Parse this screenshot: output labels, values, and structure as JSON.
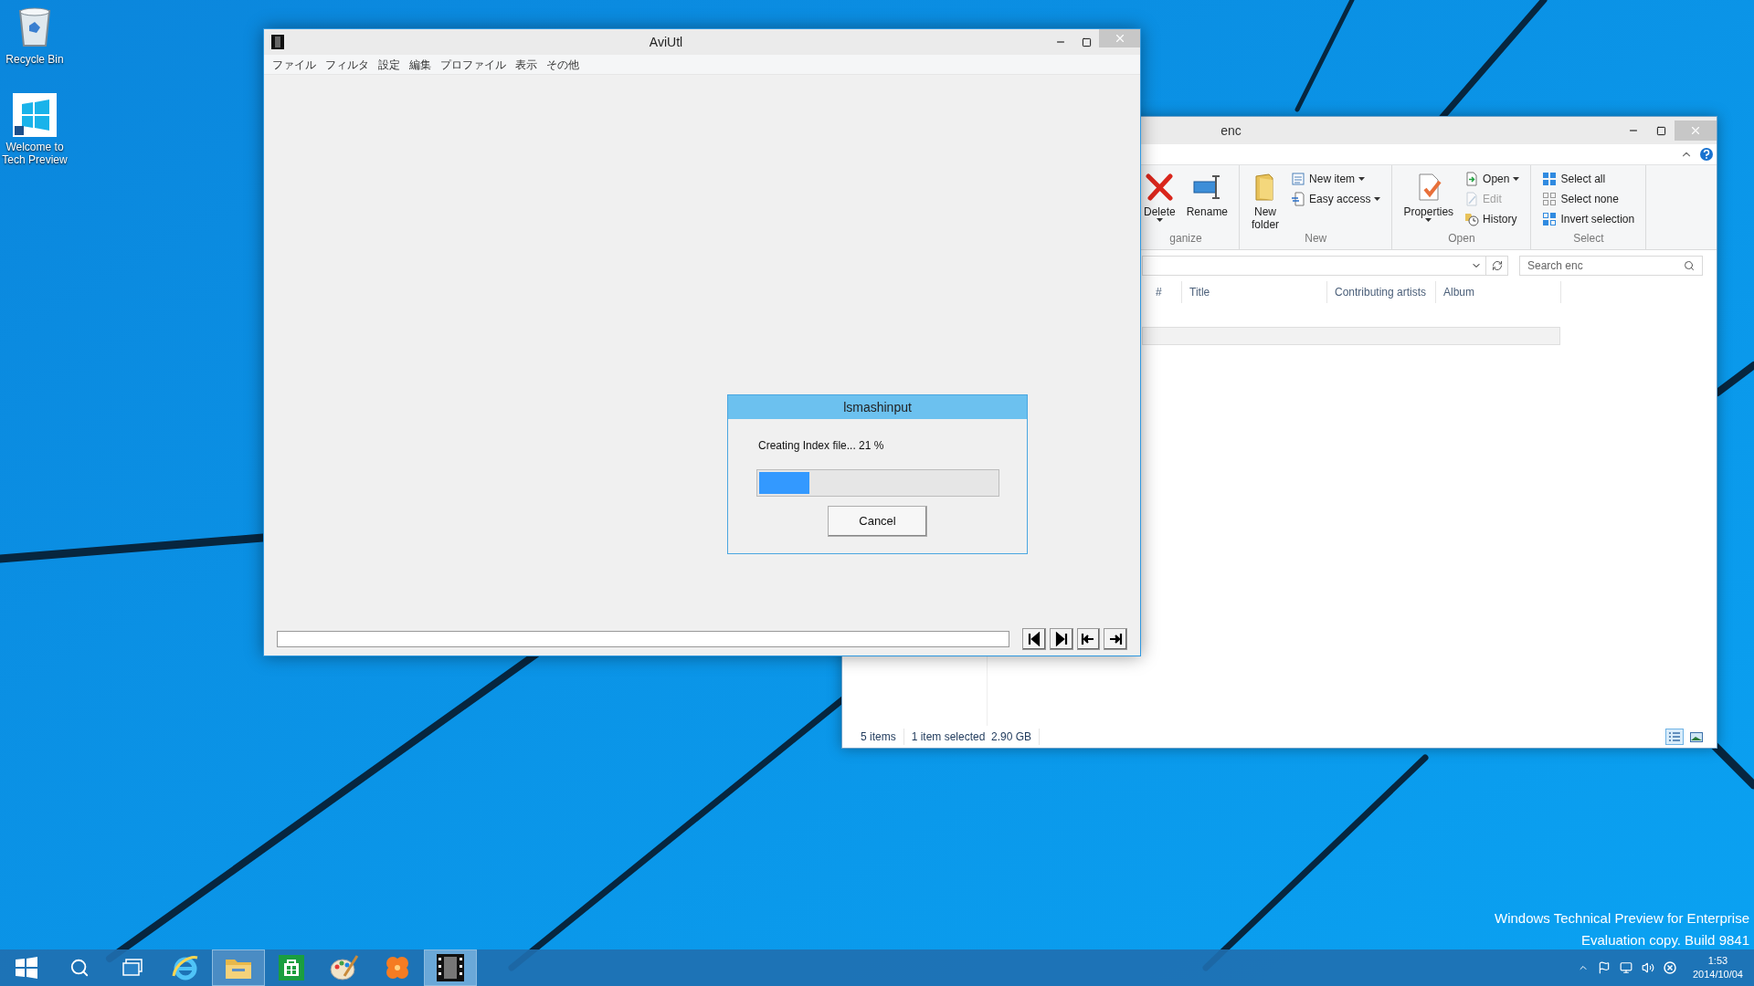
{
  "desktop_icons": [
    {
      "label": "Recycle Bin",
      "kind": "recycle"
    },
    {
      "label": "Welcome to Tech Preview",
      "kind": "welcome"
    }
  ],
  "explorer": {
    "title": "enc",
    "ribbon_groups": [
      {
        "label": "ganize",
        "items": [
          {
            "label": "Delete",
            "kind": "delete",
            "large": true,
            "dropdown": true,
            "disabled": false
          },
          {
            "label": "Rename",
            "kind": "rename",
            "large": true,
            "dropdown": false,
            "disabled": false
          }
        ]
      },
      {
        "label": "New",
        "items": [
          {
            "label_lines": [
              "New",
              "folder"
            ],
            "kind": "folder",
            "large": true,
            "dropdown": false,
            "disabled": false
          },
          {
            "label": "New item",
            "kind": "newitem",
            "large": false,
            "dropdown": true,
            "disabled": false
          },
          {
            "label": "Easy access",
            "kind": "easyaccess",
            "large": false,
            "dropdown": true,
            "disabled": false
          }
        ]
      },
      {
        "label": "Open",
        "items": [
          {
            "label": "Properties",
            "kind": "properties",
            "large": true,
            "dropdown": true,
            "disabled": false
          },
          {
            "label": "Open",
            "kind": "open",
            "large": false,
            "dropdown": true,
            "disabled": false
          },
          {
            "label": "Edit",
            "kind": "edit",
            "large": false,
            "dropdown": false,
            "disabled": true
          },
          {
            "label": "History",
            "kind": "history",
            "large": false,
            "dropdown": false,
            "disabled": false
          }
        ]
      },
      {
        "label": "Select",
        "items": [
          {
            "label": "Select all",
            "kind": "selectall",
            "large": false,
            "dropdown": false,
            "disabled": false
          },
          {
            "label": "Select none",
            "kind": "selectnone",
            "large": false,
            "dropdown": false,
            "disabled": false
          },
          {
            "label": "Invert selection",
            "kind": "invert",
            "large": false,
            "dropdown": false,
            "disabled": false
          }
        ]
      }
    ],
    "search": {
      "placeholder": "Search enc"
    },
    "columns": [
      "#",
      "Title",
      "Contributing artists",
      "Album"
    ],
    "status": [
      "5 items",
      "1 item selected  2.90 GB"
    ]
  },
  "aviutl": {
    "title": "AviUtl",
    "menu": [
      "ファイル",
      "フィルタ",
      "設定",
      "編集",
      "プロファイル",
      "表示",
      "その他"
    ],
    "dialog": {
      "title": "lsmashinput",
      "message": "Creating Index file... 21 %",
      "progress": {
        "level": 0.21
      },
      "button": "Cancel"
    }
  },
  "edition_text": [
    "Windows Technical Preview for Enterprise",
    "Evaluation copy. Build 9841"
  ],
  "taskbar": {
    "apps": [
      {
        "kind": "start",
        "running": false,
        "selected": false
      },
      {
        "kind": "search",
        "running": false,
        "selected": false
      },
      {
        "kind": "taskview",
        "running": false,
        "selected": false
      },
      {
        "kind": "ie",
        "running": false,
        "selected": false
      },
      {
        "kind": "explorer",
        "running": true,
        "selected": false
      },
      {
        "kind": "store",
        "running": false,
        "selected": false
      },
      {
        "kind": "paint",
        "running": false,
        "selected": false
      },
      {
        "kind": "clover",
        "running": false,
        "selected": false
      },
      {
        "kind": "video",
        "running": true,
        "selected": true
      }
    ],
    "clock": {
      "time": "1:53",
      "date": "2014/10/04"
    }
  }
}
